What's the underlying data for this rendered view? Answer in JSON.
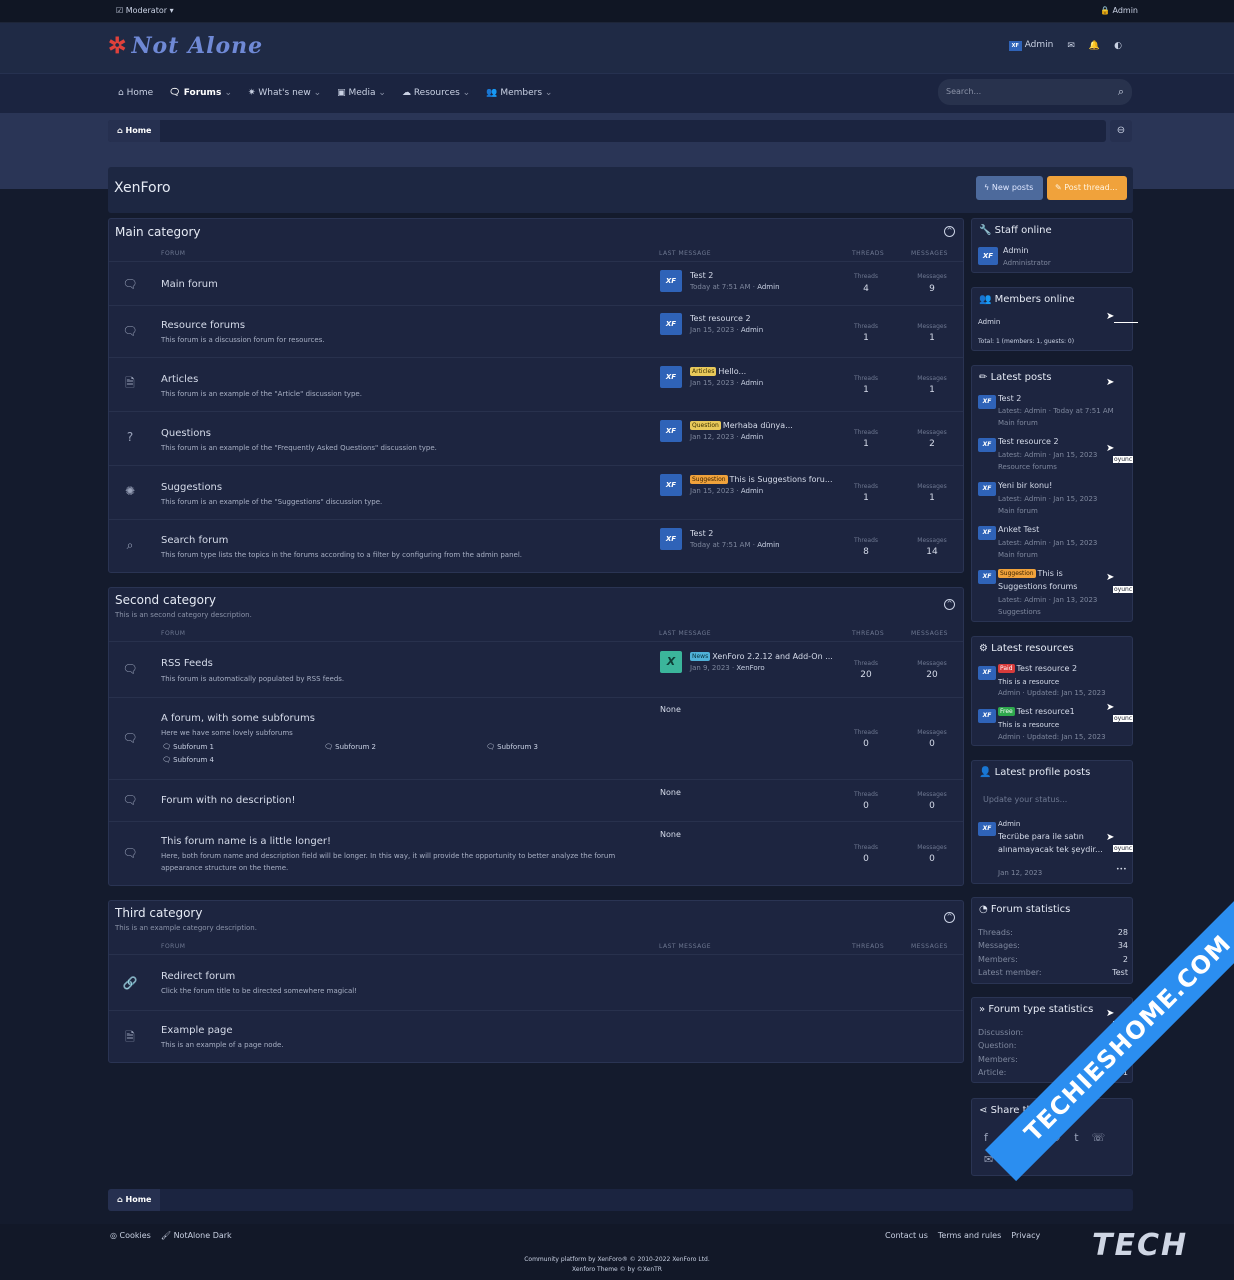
{
  "staffbar": {
    "moderator": "Moderator",
    "admin": "Admin"
  },
  "header": {
    "logo": "Not Alone",
    "user": "Admin"
  },
  "nav": {
    "home": "Home",
    "forums": "Forums",
    "whats_new": "What's new",
    "media": "Media",
    "resources": "Resources",
    "members": "Members",
    "search_placeholder": "Search..."
  },
  "breadcrumb": {
    "home": "Home"
  },
  "page": {
    "title": "XenForo",
    "new_posts": "New posts",
    "post_thread": "Post thread..."
  },
  "columns": {
    "forum": "FORUM",
    "last_message": "LAST MESSAGE",
    "threads": "THREADS",
    "messages": "MESSAGES",
    "threads_label": "Threads",
    "messages_label": "Messages"
  },
  "categories": [
    {
      "title": "Main category",
      "description": "",
      "forums": [
        {
          "name": "Main forum",
          "desc": "",
          "lm_title": "Test 2",
          "lm_tag": "",
          "lm_date": "Today at 7:51 AM",
          "lm_user": "Admin",
          "threads": "4",
          "messages": "9"
        },
        {
          "name": "Resource forums",
          "desc": "This forum is a discussion forum for resources.",
          "lm_title": "Test resource 2",
          "lm_tag": "",
          "lm_date": "Jan 15, 2023",
          "lm_user": "Admin",
          "threads": "1",
          "messages": "1"
        },
        {
          "name": "Articles",
          "desc": "This forum is an example of the \"Article\" discussion type.",
          "lm_title": "Hello...",
          "lm_tag": "Articles",
          "lm_date": "Jan 15, 2023",
          "lm_user": "Admin",
          "threads": "1",
          "messages": "1"
        },
        {
          "name": "Questions",
          "desc": "This forum is an example of the \"Frequently Asked Questions\" discussion type.",
          "lm_title": "Merhaba dünya...",
          "lm_tag": "Question",
          "lm_date": "Jan 12, 2023",
          "lm_user": "Admin",
          "threads": "1",
          "messages": "2"
        },
        {
          "name": "Suggestions",
          "desc": "This forum is an example of the \"Suggestions\" discussion type.",
          "lm_title": "This is Suggestions foru...",
          "lm_tag": "Suggestion",
          "lm_date": "Jan 15, 2023",
          "lm_user": "Admin",
          "threads": "1",
          "messages": "1"
        },
        {
          "name": "Search forum",
          "desc": "This forum type lists the topics in the forums according to a filter by configuring from the admin panel.",
          "lm_title": "Test 2",
          "lm_tag": "",
          "lm_date": "Today at 7:51 AM",
          "lm_user": "Admin",
          "threads": "8",
          "messages": "14"
        }
      ]
    },
    {
      "title": "Second category",
      "description": "This is an second category description.",
      "forums": [
        {
          "name": "RSS Feeds",
          "desc": "This forum is automatically populated by RSS feeds.",
          "lm_title": "XenForo 2.2.12 and Add-On ...",
          "lm_tag": "News",
          "lm_date": "Jan 9, 2023",
          "lm_user": "XenForo",
          "threads": "20",
          "messages": "20"
        },
        {
          "name": "A forum, with some subforums",
          "desc": "Here we have some lovely subforums",
          "lm_title": "None",
          "threads": "0",
          "messages": "0",
          "subforums": [
            "Subforum 1",
            "Subforum 2",
            "Subforum 3",
            "Subforum 4"
          ]
        },
        {
          "name": "Forum with no description!",
          "desc": "",
          "lm_title": "None",
          "threads": "0",
          "messages": "0"
        },
        {
          "name": "This forum name is a little longer!",
          "desc": "Here, both forum name and description field will be longer. In this way, it will provide the opportunity to better analyze the forum appearance structure on the theme.",
          "lm_title": "None",
          "threads": "0",
          "messages": "0"
        }
      ]
    },
    {
      "title": "Third category",
      "description": "This is an example category description.",
      "forums": [
        {
          "name": "Redirect forum",
          "desc": "Click the forum title to be directed somewhere magical!"
        },
        {
          "name": "Example page",
          "desc": "This is an example of a page node."
        }
      ]
    }
  ],
  "sidebar": {
    "staff_online": {
      "title": "Staff online",
      "name": "Admin",
      "role": "Administrator"
    },
    "members_online": {
      "title": "Members online",
      "name": "Admin",
      "total": "Total: 1 (members: 1, guests: 0)"
    },
    "latest_posts": {
      "title": "Latest posts",
      "items": [
        {
          "title": "Test 2",
          "meta": "Latest: Admin · Today at 7:51 AM",
          "forum": "Main forum"
        },
        {
          "title": "Test resource 2",
          "meta": "Latest: Admin · Jan 15, 2023",
          "forum": "Resource forums"
        },
        {
          "title": "Yeni bir konu!",
          "meta": "Latest: Admin · Jan 15, 2023",
          "forum": "Main forum"
        },
        {
          "title": "Anket Test",
          "meta": "Latest: Admin · Jan 15, 2023",
          "forum": "Main forum"
        },
        {
          "tag": "Suggestion",
          "title": "This is",
          "title2": "Suggestions forums",
          "meta": "Latest: Admin · Jan 13, 2023",
          "forum": "Suggestions"
        }
      ]
    },
    "latest_resources": {
      "title": "Latest resources",
      "items": [
        {
          "tag": "Paid",
          "title": "Test resource 2",
          "desc": "This is a resource",
          "meta": "Admin · Updated: Jan 15, 2023"
        },
        {
          "tag": "Free",
          "title": "Test resource1",
          "desc": "This is a resource",
          "meta": "Admin · Updated: Jan 15, 2023"
        }
      ]
    },
    "profile_posts": {
      "title": "Latest profile posts",
      "placeholder": "Update your status...",
      "author": "Admin",
      "line1": "Tecrübe para ile satın",
      "line2": "alınamayacak tek şeydir...",
      "date": "Jan 12, 2023",
      "more": "•••"
    },
    "forum_stats": {
      "title": "Forum statistics",
      "rows": [
        {
          "k": "Threads:",
          "v": "28"
        },
        {
          "k": "Messages:",
          "v": "34"
        },
        {
          "k": "Members:",
          "v": "2"
        },
        {
          "k": "Latest member:",
          "v": "Test"
        }
      ]
    },
    "type_stats": {
      "title": "Forum type statistics",
      "rows": [
        {
          "k": "Discussion:",
          "v": "22"
        },
        {
          "k": "Question:",
          "v": "2"
        },
        {
          "k": "Members:",
          "v": "1"
        },
        {
          "k": "Article:",
          "v": "1"
        }
      ]
    },
    "share": {
      "title": "Share this page"
    }
  },
  "overlay": {
    "label": "oyunc"
  },
  "footer": {
    "cookies": "Cookies",
    "style": "NotAlone Dark",
    "contact": "Contact us",
    "terms": "Terms and rules",
    "privacy": "Privacy",
    "copy1": "Community platform by XenForo® © 2010-2022 XenForo Ltd.",
    "copy2": "Xenforo Theme © by ©XenTR"
  },
  "watermark": {
    "site": "TECHIESHOME.COM",
    "word": "TECH"
  }
}
